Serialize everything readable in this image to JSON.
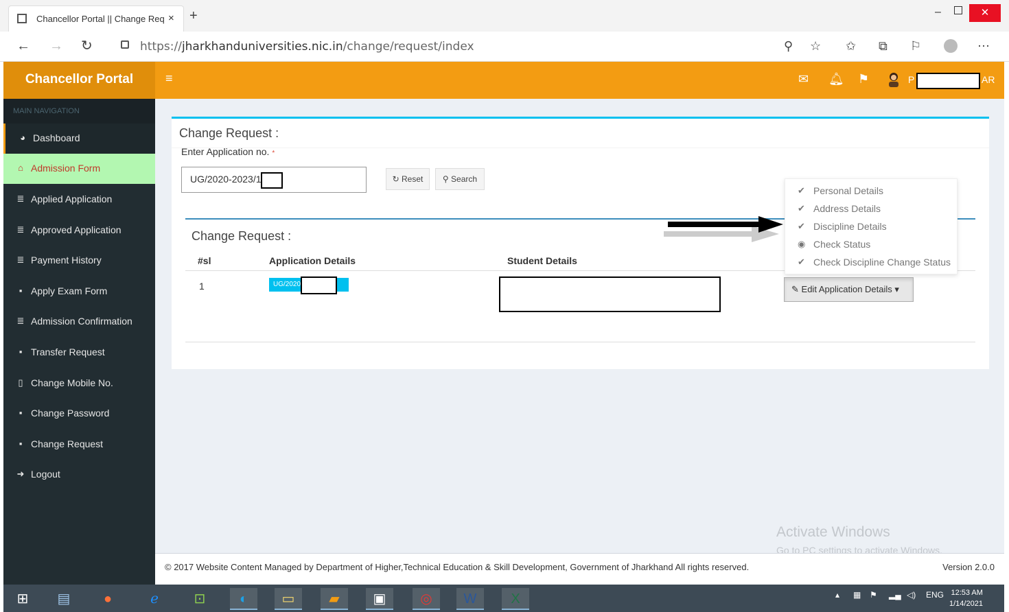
{
  "browser": {
    "tab_title": "Chancellor Portal || Change Req",
    "tab_close": "×",
    "new_tab": "+",
    "url_prefix": "https://",
    "url_host": "jharkhanduniversities.nic.in",
    "url_path": "/change/request/index"
  },
  "header": {
    "brand": "Chancellor Portal",
    "user_prefix": "P",
    "user_suffix": "AR"
  },
  "sidebar": {
    "section_label": "MAIN NAVIGATION",
    "items": [
      {
        "label": "Dashboard",
        "icon": "dashboard-icon"
      },
      {
        "label": "Admission Form",
        "icon": "bank-icon"
      },
      {
        "label": "Applied Application",
        "icon": "database-icon"
      },
      {
        "label": "Approved Application",
        "icon": "database-icon"
      },
      {
        "label": "Payment History",
        "icon": "database-icon"
      },
      {
        "label": "Apply Exam Form",
        "icon": "lock-icon"
      },
      {
        "label": "Admission Confirmation",
        "icon": "database-icon"
      },
      {
        "label": "Transfer Request",
        "icon": "lock-icon"
      },
      {
        "label": "Change Mobile No.",
        "icon": "mobile-icon"
      },
      {
        "label": "Change Password",
        "icon": "lock-icon"
      },
      {
        "label": "Change Request",
        "icon": "lock-icon"
      },
      {
        "label": "Logout",
        "icon": "sign-out-icon"
      }
    ]
  },
  "main": {
    "box_title": "Change Request :",
    "app_no_label": "Enter Application no.",
    "required_mark": "*",
    "app_no_value": "UG/2020-2023/1",
    "reset_label": "Reset",
    "search_label": "Search",
    "inner_title": "Change Request :",
    "table": {
      "headers": [
        "#sl",
        "Application Details",
        "Student Details"
      ],
      "rows": [
        {
          "sl": "1",
          "application_no": "UG/2020"
        }
      ]
    },
    "dropdown": {
      "items": [
        {
          "label": "Personal Details",
          "icon": "check-icon"
        },
        {
          "label": "Address Details",
          "icon": "check-icon"
        },
        {
          "label": "Discipline Details",
          "icon": "check-icon"
        },
        {
          "label": "Check Status",
          "icon": "eye-icon"
        },
        {
          "label": "Check Discipline Change Status",
          "icon": "check-icon"
        }
      ],
      "toggle_label": "Edit Application Details"
    }
  },
  "watermark": {
    "line1": "Activate Windows",
    "line2": "Go to PC settings to activate Windows."
  },
  "footer": {
    "text": "© 2017 Website Content Managed by Department of Higher,Technical Education & Skill Development, Government of Jharkhand All rights reserved.",
    "version": "Version 2.0.0"
  },
  "taskbar": {
    "lang": "ENG",
    "time": "12:53 AM",
    "date": "1/14/2021"
  },
  "colors": {
    "header_orange": "#f39c12",
    "brand_orange": "#e08e0b",
    "sidebar_dark": "#222d32",
    "admission_highlight": "#b3f7b1",
    "box_accent": "#00c0ef"
  }
}
